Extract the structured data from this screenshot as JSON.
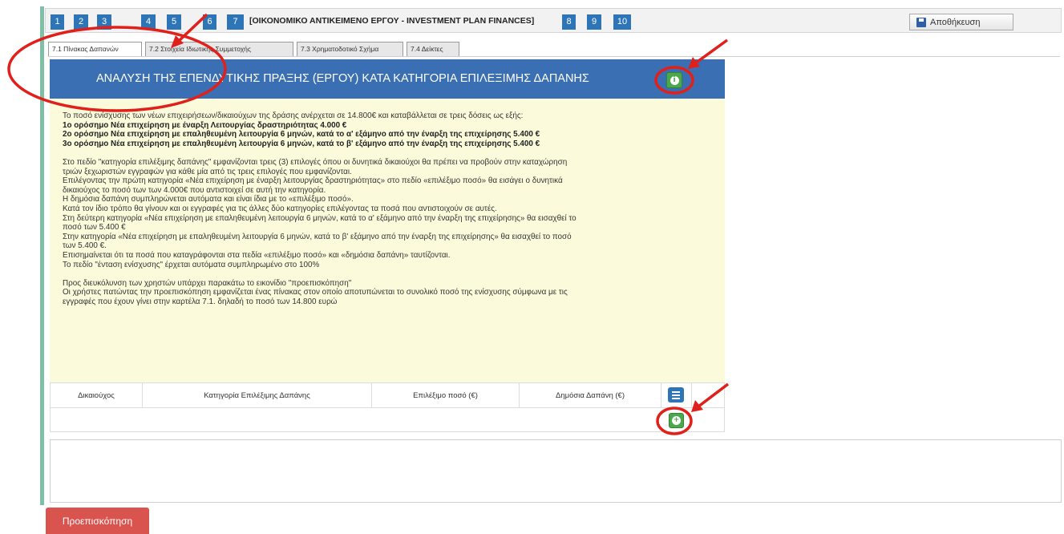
{
  "steps": {
    "s1": "1",
    "s2": "2",
    "s3": "3",
    "s4": "4",
    "s5": "5",
    "s6": "6",
    "s7": "7",
    "current_label": "[ΟΙΚΟΝΟΜΙΚΟ ΑΝΤΙΚΕΙΜΕΝΟ ΕΡΓΟΥ - INVESTMENT PLAN FINANCES]",
    "s8": "8",
    "s9": "9",
    "s10": "10"
  },
  "toolbar": {
    "save_label": "Αποθήκευση",
    "save_icon": "floppy-disk-icon"
  },
  "tabs": [
    {
      "label": "7.1 Πίνακας Δαπανών",
      "active": true
    },
    {
      "label": "7.2 Στοιχεία Ιδιωτικής Συμμετοχής",
      "active": false
    },
    {
      "label": "7.3 Χρηματοδοτικό Σχήμα",
      "active": false
    },
    {
      "label": "7.4 Δείκτες",
      "active": false
    }
  ],
  "header": {
    "title": "ΑΝΑΛΥΣΗ ΤΗΣ ΕΠΕΝΔΥΤΙΚΗΣ ΠΡΑΞΗΣ (ΕΡΓΟΥ) ΚΑΤΑ ΚΑΤΗΓΟΡΙΑ ΕΠΙΛΕΞΙΜΗΣ ΔΑΠΑΝΗΣ",
    "info_icon": "info-circle-icon"
  },
  "info": {
    "l1": "Το ποσό ενίσχυσης των νέων επιχειρήσεων/δικαιούχων της δράσης ανέρχεται σε 14.800€ και καταβάλλεται σε τρεις δόσεις ως εξής:",
    "l2": "1ο ορόσημο Νέα επιχείρηση με έναρξη Λειτουργίας δραστηριότητας 4.000 €",
    "l3": "2ο ορόσημο Νέα επιχείρηση με επαληθευμένη λειτουργία 6 μηνών, κατά το α' εξάμηνο από την έναρξη της επιχείρησης 5.400 €",
    "l4": "3ο ορόσημο Νέα επιχείρηση με επαληθευμένη λειτουργία 6 μηνών, κατά το β' εξάμηνο από την έναρξη της επιχείρησης 5.400 €",
    "l5": "Στο πεδίο \"κατηγορία επιλέξιμης δαπάνης\" εμφανίζονται τρεις (3) επιλογές όπου οι δυνητικά δικαιούχοι θα πρέπει να προβούν στην καταχώρηση",
    "l6": "τριών ξεχωριστών εγγραφών για κάθε μία από τις τρεις επιλογές που εμφανίζονται.",
    "l7": "Επιλέγοντας την πρώτη κατηγορία «Νέα επιχείρηση με έναρξη λειτουργίας δραστηριότητας» στο πεδίο «επιλέξιμο ποσό» θα εισάγει ο δυνητικά",
    "l8": "δικαιούχος το ποσό των των 4.000€ που αντιστοιχεί σε αυτή την κατηγορία.",
    "l9": "Η δημόσια δαπάνη συμπληρώνεται αυτόματα και είναι ίδια με το «επιλέξιμο ποσό».",
    "l10": "Κατά τον ίδιο τρόπο θα γίνουν και οι εγγραφές για τις άλλες δύο κατηγορίες επιλέγοντας τα ποσά που αντιστοιχούν σε αυτές.",
    "l11": "Στη δεύτερη κατηγορία «Νέα επιχείρηση με επαληθευμένη λειτουργία 6 μηνών, κατά το α' εξάμηνο από την έναρξη της επιχείρησης» θα εισαχθεί το",
    "l12": "ποσό των 5.400 €",
    "l13": "Στην κατηγορία «Νέα επιχείρηση με επαληθευμένη λειτουργία 6 μηνών, κατά το β' εξάμηνο από την έναρξη της επιχείρησης» θα εισαχθεί το ποσό",
    "l14": "των 5.400 €.",
    "l15": "Επισημαίνεται ότι τα ποσά που καταγράφονται στα πεδία «επιλέξιμο ποσό» και «δημόσια δαπάνη» ταυτίζονται.",
    "l16": "Το πεδίο \"ένταση ενίσχυσης\" έρχεται αυτόματα συμπληρωμένο στο 100%",
    "l17": "Προς διευκόλυνση των χρηστών υπάρχει παρακάτω το εικονίδιο \"προεπισκόπηση\"",
    "l18": "Οι χρήστες πατώντας την προεπισκόπηση εμφανίζεται ένας πίνακας στον οποίο αποτυπώνεται το συνολικό ποσό της ενίσχυσης σύμφωνα με τις",
    "l19": "εγγραφές που έχουν γίνει στην καρτέλα 7.1. δηλαδή το ποσό των 14.800 ευρώ"
  },
  "table": {
    "columns": [
      "Δικαιούχος",
      "Κατηγορία Επιλέξιμης Δαπάνης",
      "Επιλέξιμο ποσό (€)",
      "Δημόσια Δαπάνη (€)"
    ],
    "list_icon": "list-icon",
    "add_icon": "plus-circle-icon"
  },
  "footer": {
    "preview_label": "Προεπισκόπηση"
  },
  "colors": {
    "step_blue": "#2d75b6",
    "header_blue": "#3a6fb3",
    "panel_yellow": "#fbfbdc",
    "green": "#4da84d",
    "preview_red": "#d9534f",
    "annotation_red": "#e0201b"
  }
}
